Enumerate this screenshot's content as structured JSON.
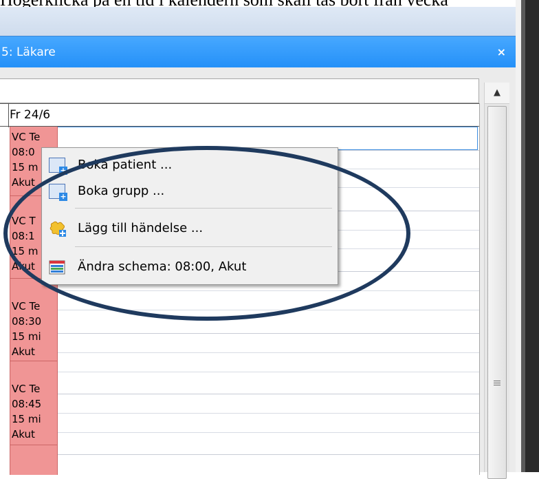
{
  "caption": "Högerklicka på en tid i kalendern som skall tas bort från vecka",
  "window": {
    "title": "5: Läkare",
    "close_glyph": "×"
  },
  "grid": {
    "day_label": "Fr 24/6",
    "slots": [
      {
        "line1": "VC Te",
        "line2": "08:0",
        "line3": "15 m",
        "line4": "Akut"
      },
      {
        "line1": "VC T",
        "line2": "08:1",
        "line3": "15 m",
        "line4": "Akut"
      },
      {
        "line1": "VC Te",
        "line2": "08:30",
        "line3": "15 mi",
        "line4": "Akut"
      },
      {
        "line1": "VC Te",
        "line2": "08:45",
        "line3": "15 mi",
        "line4": "Akut"
      }
    ]
  },
  "context_menu": {
    "items": [
      {
        "label": "Boka patient ...",
        "icon": "book-patient-icon"
      },
      {
        "label": "Boka grupp ...",
        "icon": "book-group-icon"
      },
      {
        "label": "Lägg till händelse ...",
        "icon": "add-event-icon"
      },
      {
        "label": "Ändra schema:  08:00, Akut",
        "icon": "schedule-icon"
      }
    ]
  },
  "scrollbar": {
    "up_glyph": "▲"
  },
  "colors": {
    "titlebar": "#2490f8",
    "slot_fill": "#f09595",
    "highlight_ellipse": "#1f3a5e"
  }
}
